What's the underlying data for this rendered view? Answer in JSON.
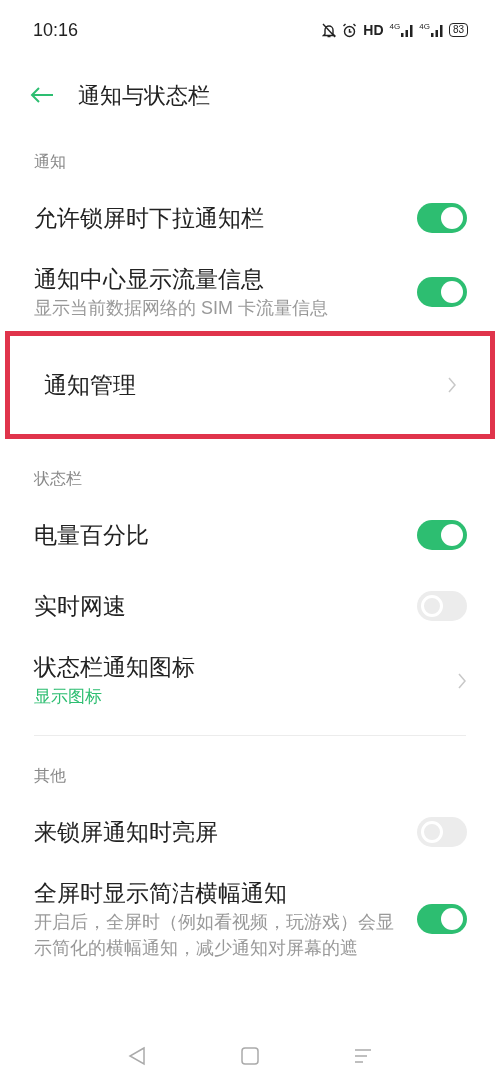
{
  "status_bar": {
    "time": "10:16",
    "hd": "HD",
    "signals": [
      "4G",
      "4G"
    ],
    "battery": "83"
  },
  "header": {
    "title": "通知与状态栏"
  },
  "sections": [
    {
      "title": "通知",
      "divider_above": false,
      "items": [
        {
          "kind": "toggle",
          "label": "允许锁屏时下拉通知栏",
          "on": true,
          "highlighted": false
        },
        {
          "kind": "toggle",
          "label": "通知中心显示流量信息",
          "subtitle": "显示当前数据网络的 SIM 卡流量信息",
          "on": true,
          "highlighted": false
        },
        {
          "kind": "link",
          "label": "通知管理",
          "highlighted": true
        }
      ]
    },
    {
      "title": "状态栏",
      "divider_above": false,
      "items": [
        {
          "kind": "toggle",
          "label": "电量百分比",
          "on": true,
          "highlighted": false
        },
        {
          "kind": "toggle",
          "label": "实时网速",
          "on": false,
          "highlighted": false
        },
        {
          "kind": "link",
          "label": "状态栏通知图标",
          "value": "显示图标",
          "highlighted": false
        }
      ]
    },
    {
      "title": "其他",
      "divider_above": true,
      "items": [
        {
          "kind": "toggle",
          "label": "来锁屏通知时亮屏",
          "on": false,
          "highlighted": false
        },
        {
          "kind": "toggle",
          "label": "全屏时显示简洁横幅通知",
          "subtitle": "开启后，全屏时（例如看视频，玩游戏）会显示简化的横幅通知，减少通知对屏幕的遮",
          "on": true,
          "highlighted": false
        }
      ]
    }
  ]
}
